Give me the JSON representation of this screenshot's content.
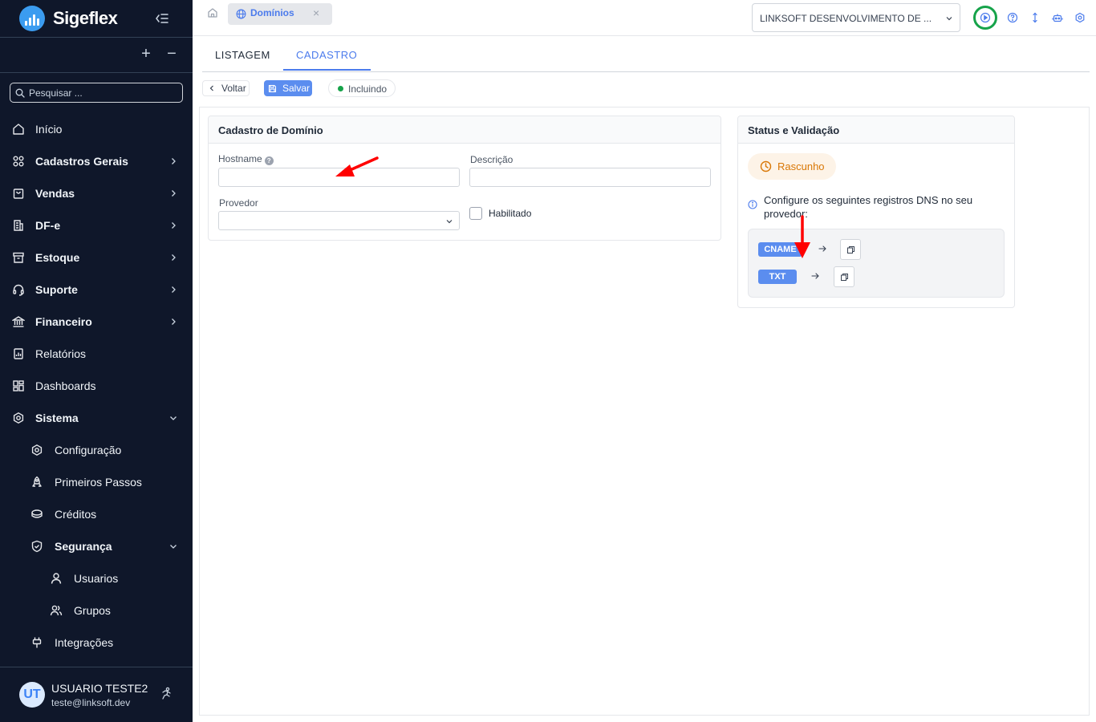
{
  "brand": {
    "name": "Sigeflex"
  },
  "search": {
    "placeholder": "Pesquisar ..."
  },
  "menu": [
    {
      "label": "Início",
      "icon": "home-icon"
    },
    {
      "label": "Cadastros Gerais",
      "icon": "grid-icon"
    },
    {
      "label": "Vendas",
      "icon": "shopping-bag-icon"
    },
    {
      "label": "DF-e",
      "icon": "document-icon"
    },
    {
      "label": "Estoque",
      "icon": "archive-box-icon"
    },
    {
      "label": "Suporte",
      "icon": "headset-icon"
    },
    {
      "label": "Financeiro",
      "icon": "bank-icon"
    },
    {
      "label": "Relatórios",
      "icon": "report-icon"
    },
    {
      "label": "Dashboards",
      "icon": "dashboard-icon"
    },
    {
      "label": "Sistema",
      "icon": "gear-icon"
    },
    {
      "label": "Configuração",
      "icon": "gear-icon"
    },
    {
      "label": "Primeiros Passos",
      "icon": "rocket-icon"
    },
    {
      "label": "Créditos",
      "icon": "coins-icon"
    },
    {
      "label": "Segurança",
      "icon": "shield-icon"
    },
    {
      "label": "Usuarios",
      "icon": "user-icon"
    },
    {
      "label": "Grupos",
      "icon": "users-icon"
    },
    {
      "label": "Integrações",
      "icon": "plug-icon"
    }
  ],
  "user": {
    "initials": "UT",
    "name": "USUARIO TESTE2",
    "email": "teste@linksoft.dev"
  },
  "topbar": {
    "open_tab": "Domínios",
    "company": "LINKSOFT DESENVOLVIMENTO DE ..."
  },
  "view_tabs": [
    "LISTAGEM",
    "CADASTRO"
  ],
  "toolbar": {
    "back_label": "Voltar",
    "save_label": "Salvar",
    "status_label": "Incluindo"
  },
  "form": {
    "title": "Cadastro de Domínio",
    "hostname_label": "Hostname",
    "hostname_value": "",
    "descricao_label": "Descrição",
    "descricao_value": "",
    "provedor_label": "Provedor",
    "provedor_value": "",
    "habilitado_label": "Habilitado"
  },
  "status_card": {
    "title": "Status e Validação",
    "badge": "Rascunho",
    "info": "Configure os seguintes registros DNS no seu provedor:",
    "records": [
      {
        "type": "CNAME"
      },
      {
        "type": "TXT"
      }
    ]
  },
  "colors": {
    "sidebar_bg": "#0f172a",
    "accent": "#4b7bec",
    "primary_button": "#5b8def",
    "success": "#16a34a",
    "draft": "#d97706",
    "annotation_arrow": "#ff0000"
  }
}
